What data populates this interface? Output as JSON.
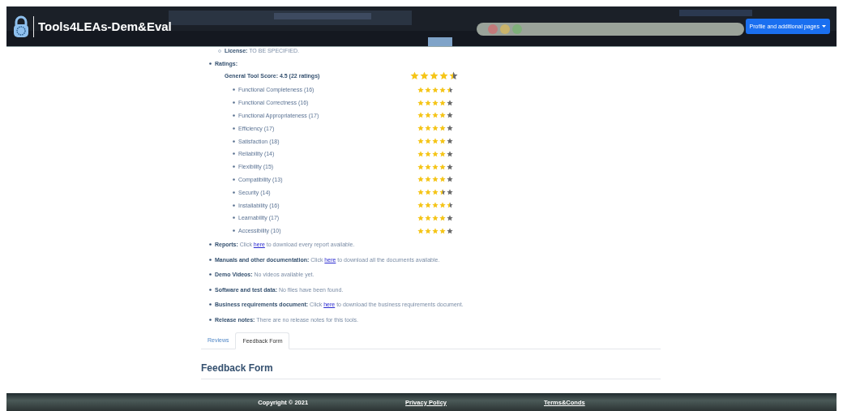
{
  "header": {
    "title": "Tools4LEAs-Dem&Eval",
    "menu_button": "Profile and additional pages"
  },
  "license": {
    "label": "License:",
    "text": "TO BE SPECIFIED."
  },
  "ratings": {
    "label": "Ratings:",
    "general": {
      "label": "General Tool Score: 4.5 (22 ratings)",
      "stars": 4.5
    },
    "items": [
      {
        "label": "Functional Completeness (16)",
        "stars": 4.5
      },
      {
        "label": "Functional Correctness (16)",
        "stars": 4
      },
      {
        "label": "Functional Appropriateness (17)",
        "stars": 4
      },
      {
        "label": "Efficiency (17)",
        "stars": 4
      },
      {
        "label": "Satisfaction (18)",
        "stars": 4
      },
      {
        "label": "Reliability (14)",
        "stars": 4
      },
      {
        "label": "Flexibility (15)",
        "stars": 4
      },
      {
        "label": "Compatibility (13)",
        "stars": 4
      },
      {
        "label": "Security (14)",
        "stars": 3.5
      },
      {
        "label": "Installability (16)",
        "stars": 4.5
      },
      {
        "label": "Learnability (17)",
        "stars": 4
      },
      {
        "label": "Accessibility (10)",
        "stars": 4
      }
    ]
  },
  "info": [
    {
      "label": "Reports:",
      "before": "Click ",
      "link": "here",
      "after": " to download every report available."
    },
    {
      "label": "Manuals and other documentation:",
      "before": "Click ",
      "link": "here",
      "after": " to download all the documents available."
    },
    {
      "label": "Demo Videos:",
      "before": "No videos available yet."
    },
    {
      "label": "Software and test data:",
      "before": "No files have been found."
    },
    {
      "label": "Business requirements document:",
      "before": "Click ",
      "link": "here",
      "after": " to download the business requirements document."
    },
    {
      "label": "Release notes:",
      "before": "There are no release notes for this tools."
    }
  ],
  "tabs": [
    {
      "label": "Reviews",
      "selected": false
    },
    {
      "label": "Feedback Form",
      "selected": true
    }
  ],
  "section_heading": "Feedback Form",
  "footer": {
    "copyright": "Copyright © 2021",
    "links": [
      "Privacy Policy",
      "Terms&Conds"
    ]
  }
}
